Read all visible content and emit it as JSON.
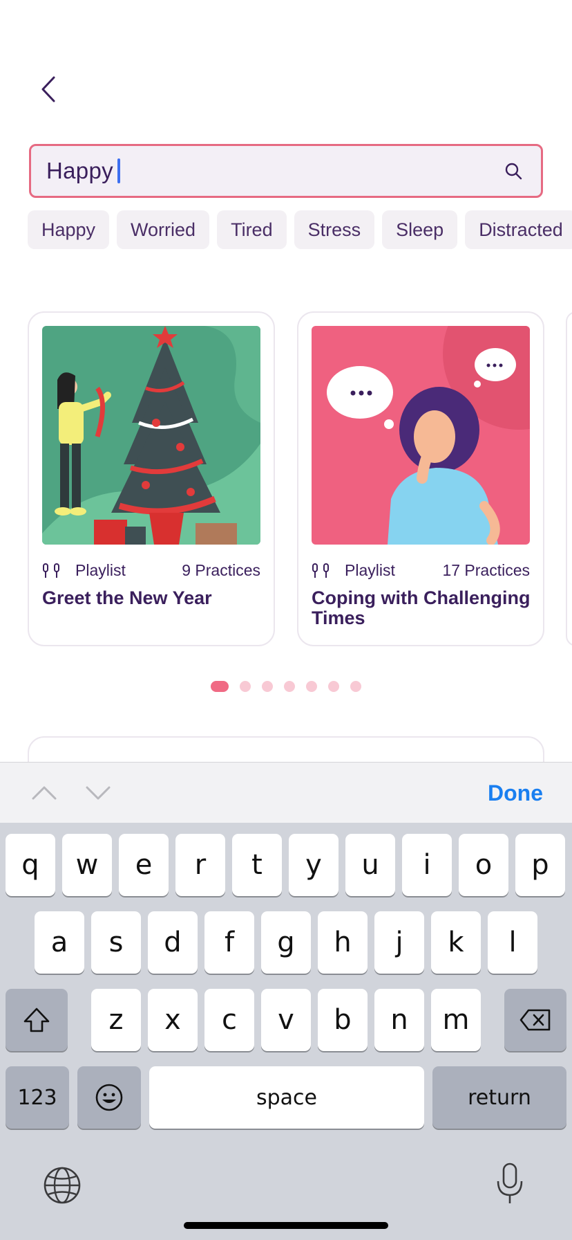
{
  "search": {
    "value": "Happy"
  },
  "chips": [
    "Happy",
    "Worried",
    "Tired",
    "Stress",
    "Sleep",
    "Distracted"
  ],
  "cards": [
    {
      "type": "Playlist",
      "count": "9 Practices",
      "title": "Greet the New Year"
    },
    {
      "type": "Playlist",
      "count": "17 Practices",
      "title": "Coping with Challenging Times"
    }
  ],
  "carousel": {
    "total_pages": 7,
    "current_page": 1
  },
  "keyboard": {
    "done_label": "Done",
    "row1": [
      "q",
      "w",
      "e",
      "r",
      "t",
      "y",
      "u",
      "i",
      "o",
      "p"
    ],
    "row2": [
      "a",
      "s",
      "d",
      "f",
      "g",
      "h",
      "j",
      "k",
      "l"
    ],
    "row3": [
      "z",
      "x",
      "c",
      "v",
      "b",
      "n",
      "m"
    ],
    "numbers_label": "123",
    "space_label": "space",
    "return_label": "return"
  },
  "colors": {
    "accent": "#f06a84",
    "text": "#3a1f5c",
    "keyboard_blue": "#1a7ff0"
  }
}
